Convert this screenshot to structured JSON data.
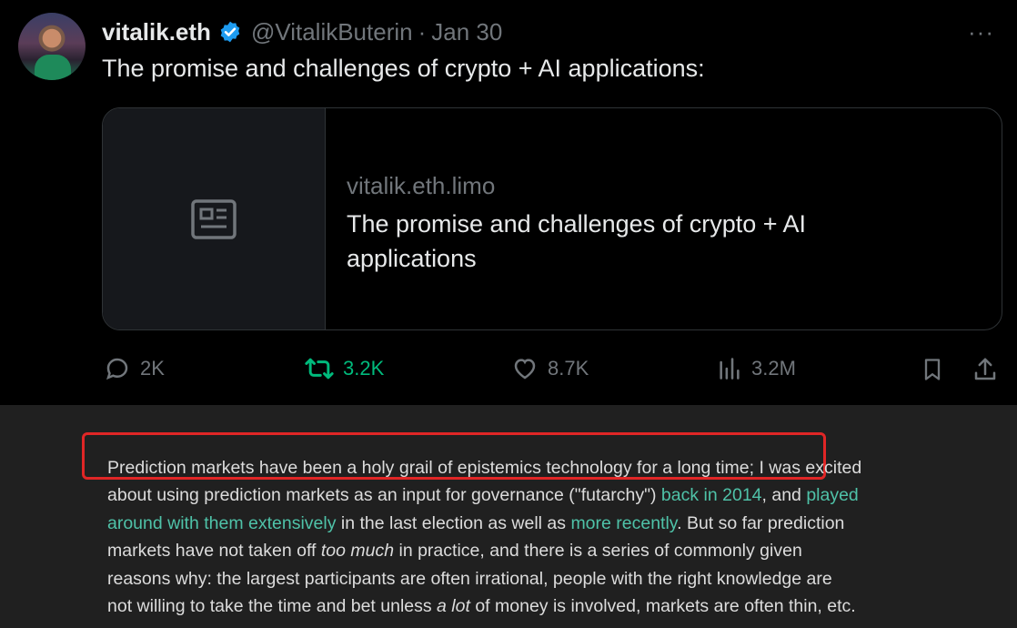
{
  "tweet": {
    "author": {
      "display_name": "vitalik.eth",
      "handle": "@VitalikButerin",
      "separator": "·",
      "date": "Jan 30",
      "verified_color": "#1d9bf0"
    },
    "more_label": "···",
    "text": "The promise and challenges of crypto + AI applications:",
    "card": {
      "domain": "vitalik.eth.limo",
      "title": "The promise and challenges of crypto + AI applications",
      "thumb_icon": "article-icon"
    },
    "actions": {
      "replies": "2K",
      "reposts": "3.2K",
      "likes": "8.7K",
      "views": "3.2M",
      "repost_color": "#00ba7c"
    }
  },
  "article": {
    "line1_highlighted": "Prediction markets have been a holy grail of epistemics technology for a long time;",
    "line1_rest": " I was excited",
    "line2_a": "about using prediction markets as an input for governance (\"futarchy\") ",
    "line2_link": "back in 2014",
    "line2_b": ", and ",
    "line2_link2": "played",
    "line3_link": "around with them extensively",
    "line3_a": " in the last election as well as ",
    "line3_link2": "more recently",
    "line3_b": ". But so far prediction",
    "line4_a": "markets have not taken off ",
    "line4_em": "too much",
    "line4_b": " in practice, and there is a series of commonly given",
    "line5": "reasons why: the largest participants are often irrational, people with the right knowledge are",
    "line6_a": "not willing to take the time and bet unless ",
    "line6_em": "a lot",
    "line6_b": " of money is involved, markets are often thin, etc.",
    "link_color": "#4fc2a8",
    "highlight_color": "#e02626"
  }
}
